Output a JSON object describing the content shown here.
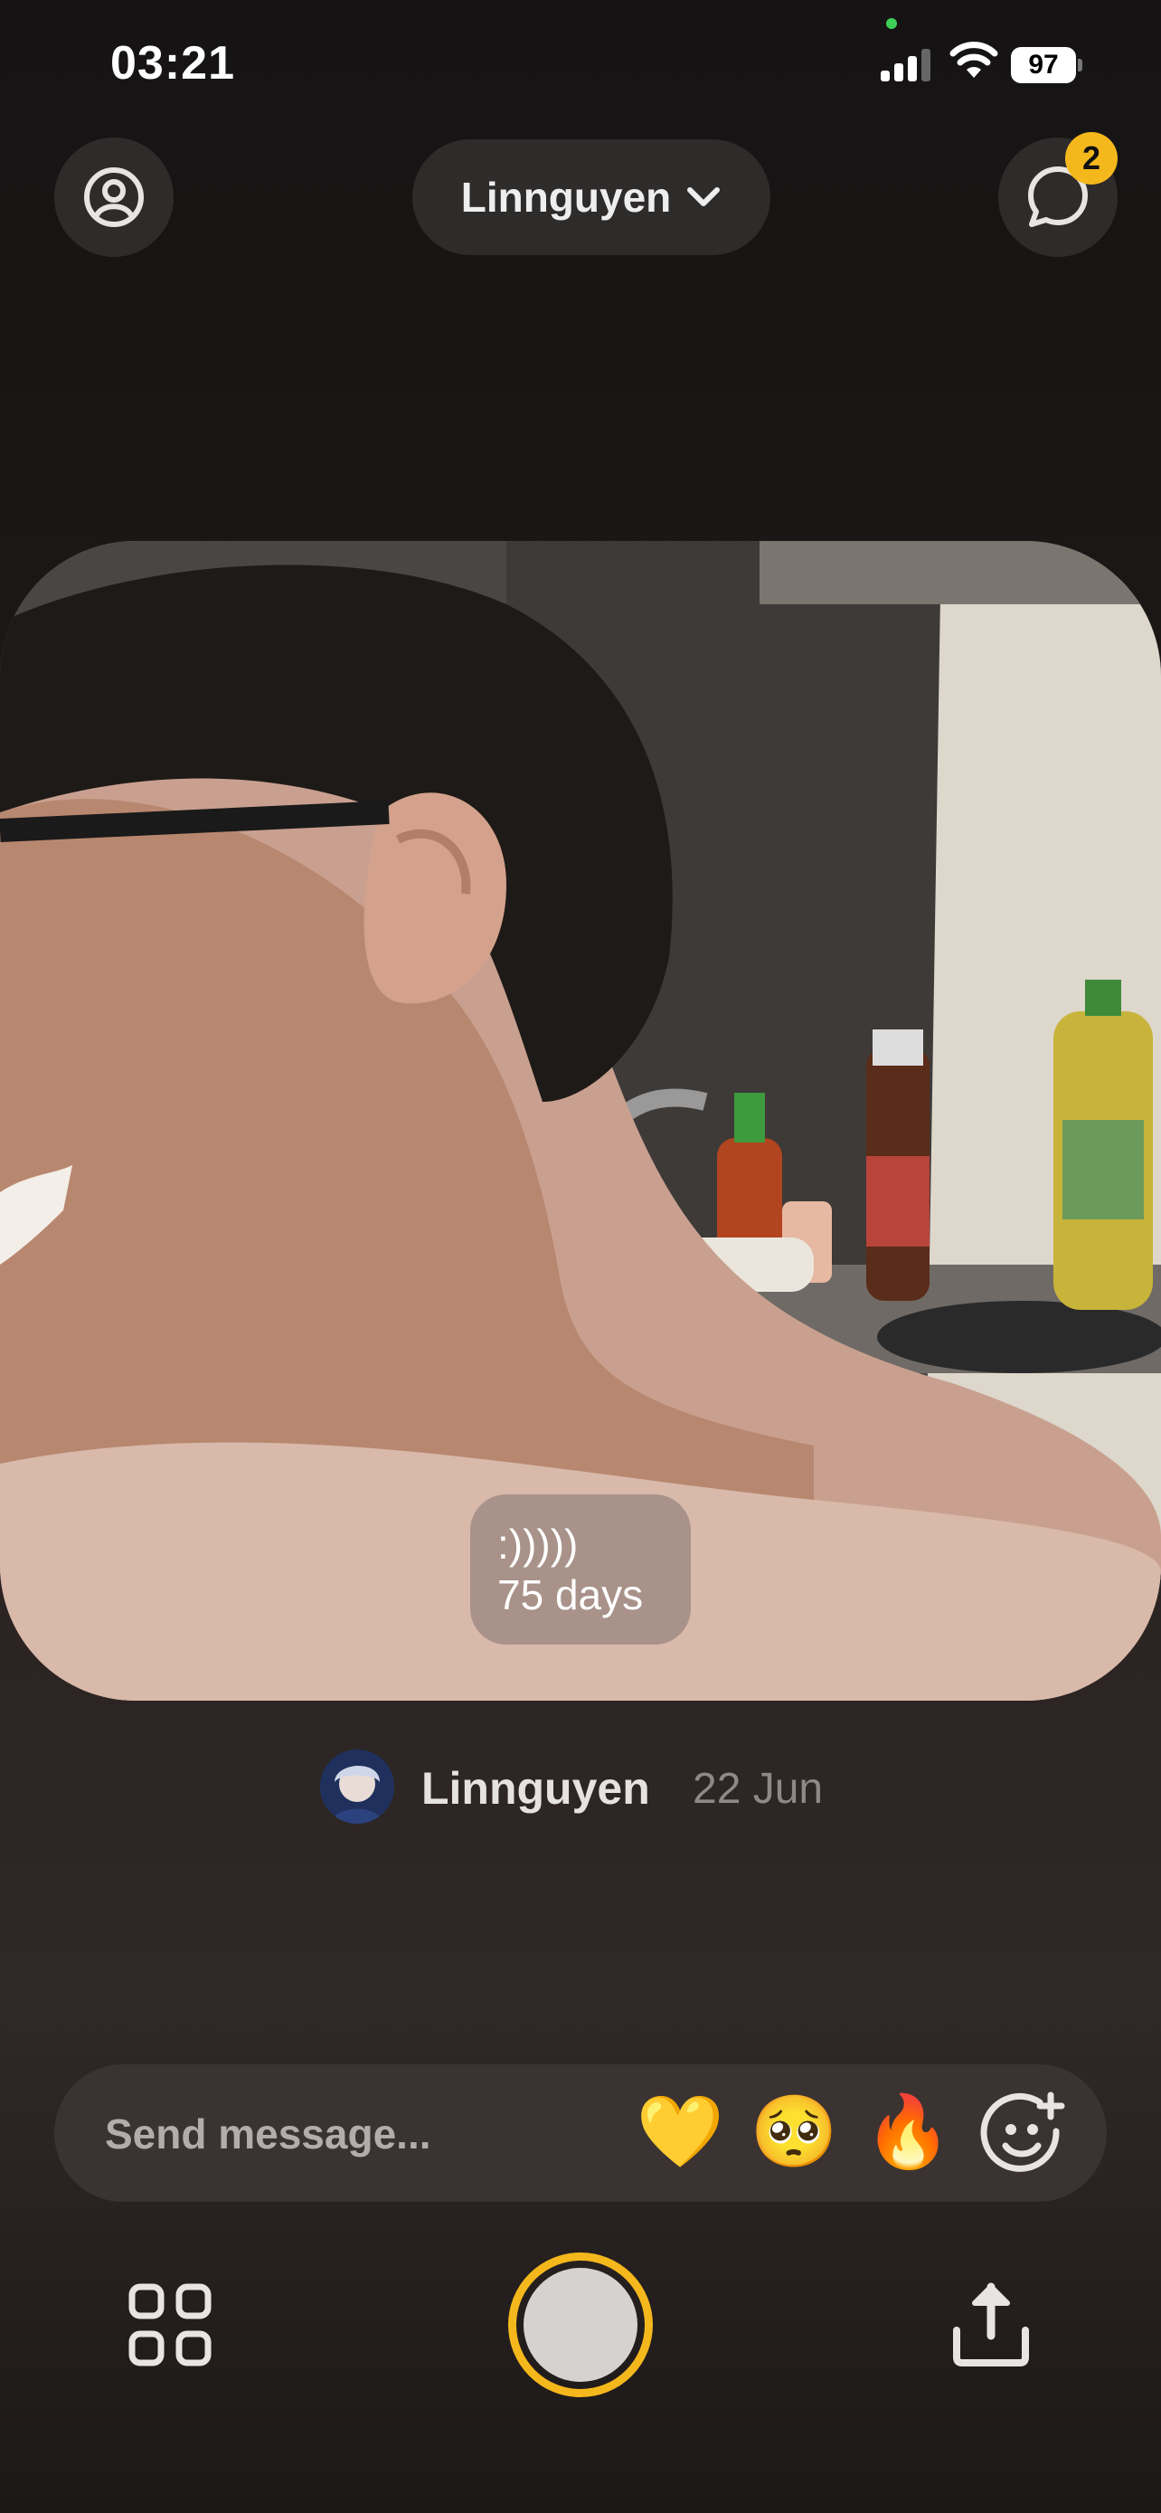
{
  "status_bar": {
    "time": "03:21",
    "battery": "97",
    "icons": [
      "cellular-signal-icon",
      "wifi-icon",
      "battery-icon"
    ]
  },
  "header": {
    "profile_icon": "profile-icon",
    "friend_picker_label": "Linnguyen",
    "friend_picker_icon": "chevron-down-icon",
    "chat_icon": "chat-bubble-icon",
    "chat_badge": "2"
  },
  "post": {
    "caption_line1": ":)))))",
    "caption_line2": "75 days",
    "author_name": "Linnguyen",
    "date": "22 Jun"
  },
  "composer": {
    "placeholder": "Send message...",
    "reactions": [
      "💛",
      "🥺",
      "🔥"
    ],
    "add_reaction_icon": "smiley-plus-icon"
  },
  "toolbar": {
    "grid_icon": "grid-icon",
    "shutter_icon": "shutter-button",
    "share_icon": "share-upload-icon"
  },
  "colors": {
    "accent": "#f5b81c",
    "background": "#1d1918",
    "pill": "#2e2b2b",
    "composer": "#3a3331"
  }
}
